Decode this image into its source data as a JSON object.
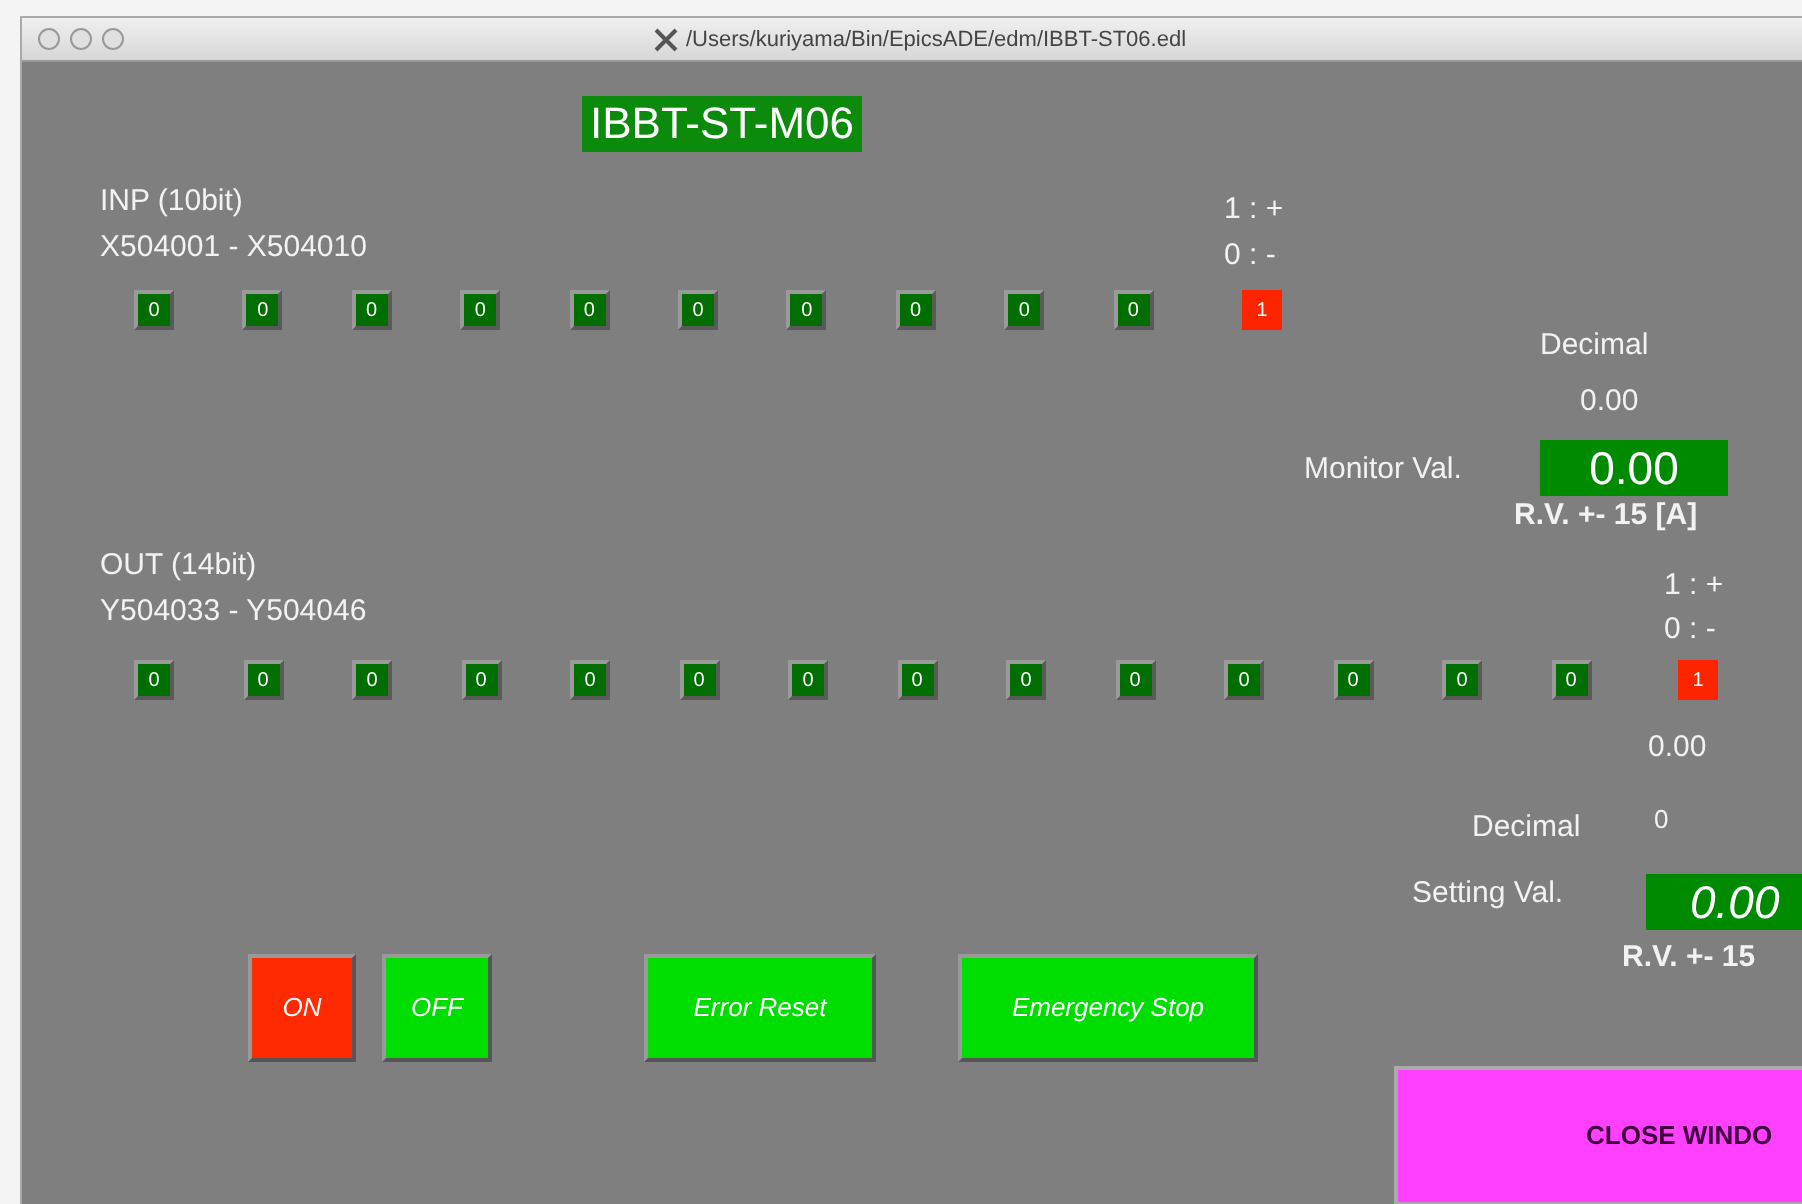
{
  "window": {
    "title": "/Users/kuriyama/Bin/EpicsADE/edm/IBBT-ST06.edl"
  },
  "display_title": "IBBT-ST-M06",
  "input": {
    "label": "INP (10bit)",
    "range": "X504001 - X504010",
    "legend": [
      "1 : +",
      "0 : -"
    ],
    "bits": [
      {
        "text": "0",
        "on": false
      },
      {
        "text": "0",
        "on": false
      },
      {
        "text": "0",
        "on": false
      },
      {
        "text": "0",
        "on": false
      },
      {
        "text": "0",
        "on": false
      },
      {
        "text": "0",
        "on": false
      },
      {
        "text": "0",
        "on": false
      },
      {
        "text": "0",
        "on": false
      },
      {
        "text": "0",
        "on": false
      },
      {
        "text": "0",
        "on": false
      }
    ],
    "indicator": {
      "text": "1",
      "on": true
    }
  },
  "monitor": {
    "decimal_label": "Decimal",
    "decimal_value": "0.00",
    "label": "Monitor Val.",
    "value": "0.00",
    "range_note": "R.V. +- 15 [A]"
  },
  "output": {
    "label": "OUT (14bit)",
    "range": "Y504033 - Y504046",
    "legend": [
      "1 : +",
      "0 : -"
    ],
    "bits": [
      {
        "text": "0",
        "on": false
      },
      {
        "text": "0",
        "on": false
      },
      {
        "text": "0",
        "on": false
      },
      {
        "text": "0",
        "on": false
      },
      {
        "text": "0",
        "on": false
      },
      {
        "text": "0",
        "on": false
      },
      {
        "text": "0",
        "on": false
      },
      {
        "text": "0",
        "on": false
      },
      {
        "text": "0",
        "on": false
      },
      {
        "text": "0",
        "on": false
      },
      {
        "text": "0",
        "on": false
      },
      {
        "text": "0",
        "on": false
      },
      {
        "text": "0",
        "on": false
      },
      {
        "text": "0",
        "on": false
      }
    ],
    "indicator": {
      "text": "1",
      "on": true
    },
    "value_below": "0.00"
  },
  "setting": {
    "decimal_label": "Decimal",
    "decimal_value": "0",
    "label": "Setting Val.",
    "value": "0.00",
    "range_note": "R.V. +- 15"
  },
  "buttons": [
    {
      "label": "ON",
      "color": "#ff2a00"
    },
    {
      "label": "OFF",
      "color": "#00dd00"
    },
    {
      "label": "Error Reset",
      "color": "#00dd00"
    },
    {
      "label": "Emergency Stop",
      "color": "#00dd00"
    }
  ],
  "close_button": {
    "label": "CLOSE WINDO"
  }
}
